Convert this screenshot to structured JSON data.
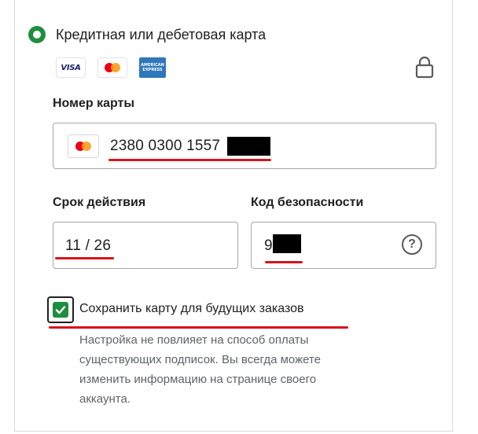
{
  "payment_method": {
    "title": "Кредитная или дебетовая карта",
    "selected": true,
    "brands": {
      "visa": "VISA",
      "amex_line1": "AMERICAN",
      "amex_line2": "EXPRESS"
    }
  },
  "card_number": {
    "label": "Номер карты",
    "value": "2380 0300 1557",
    "icon": "mastercard-icon"
  },
  "expiry": {
    "label": "Срок действия",
    "value": "11 / 26"
  },
  "security_code": {
    "label": "Код безопасности",
    "value": "9",
    "help": "?"
  },
  "save_card": {
    "label": "Сохранить карту для будущих заказов",
    "checked": true,
    "note_lines": [
      "Настройка не повлияет на способ оплаты",
      "существующих подписок. Вы всегда можете",
      "изменить информацию на странице своего",
      "аккаунта."
    ]
  },
  "colors": {
    "accent_green": "#1e8e3e",
    "annotation_red": "#d7141b"
  }
}
